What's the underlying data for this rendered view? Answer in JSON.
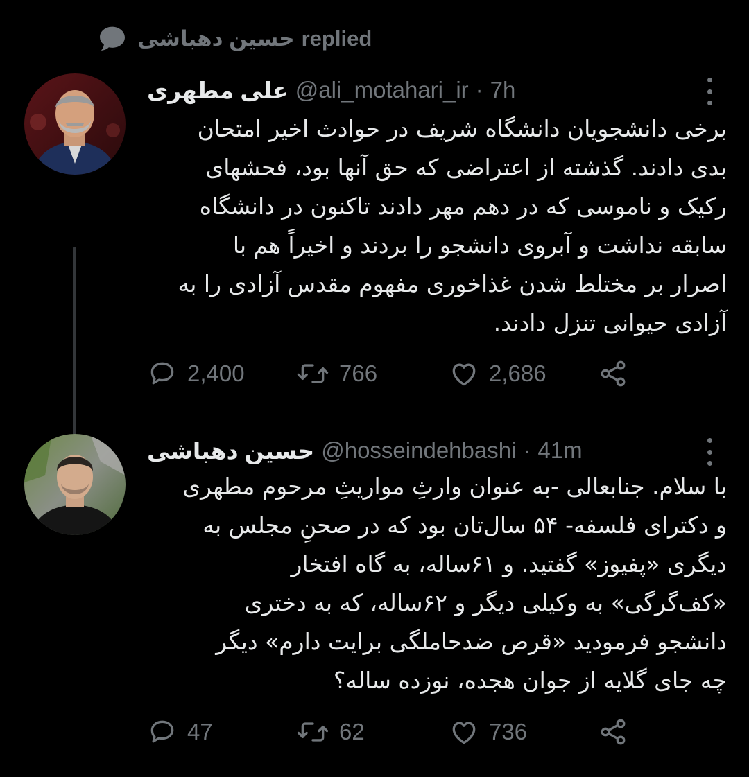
{
  "context": {
    "icon": "speech-bubble-icon",
    "name": "حسین دهباشی",
    "action": "replied"
  },
  "tweets": [
    {
      "name": "علی مطهری",
      "handle": "@ali_motahari_ir",
      "separator": "·",
      "time": "7h",
      "lines": [
        "برخی دانشجویان دانشگاه شریف در حوادث اخیر امتحان",
        "بدی دادند. گذشته از اعتراضی که حق آنها بود، فحشهای",
        "رکیک و ناموسی که در دهم مهر دادند تاکنون در دانشگاه",
        "سابقه نداشت و آبروی دانشجو را بردند و اخیراً هم با",
        "اصرار بر مختلط شدن غذاخوری مفهوم مقدس آزادی را به",
        "آزادی حیوانی تنزل دادند."
      ],
      "replies": "2,400",
      "retweets": "766",
      "likes": "2,686"
    },
    {
      "name": "حسین دهباشی",
      "handle": "@hosseindehbashi",
      "separator": "·",
      "time": "41m",
      "lines": [
        "با سلام. جنابعالی -به عنوان وارثِ مواریثِ مرحوم مطهری",
        "و دکترای فلسفه- ۵۴ سال‌تان بود که در صحنِ مجلس به",
        "دیگری «پفیوز» گفتید. و ۶۱ساله، به گاه افتخار",
        "«کف‌گرگی» به وکیلی دیگر و ۶۲ساله، که به دختری",
        "دانشجو فرمودید «قرص ضدحاملگی برایت دارم» دیگر",
        "چه جای گلایه از جوان هجده، نوزده ساله؟"
      ],
      "replies": "47",
      "retweets": "62",
      "likes": "736"
    }
  ],
  "colors": {
    "background": "#000000",
    "primary_text": "#e7e9ea",
    "secondary_text": "#71767b",
    "thread_line": "#333639"
  }
}
